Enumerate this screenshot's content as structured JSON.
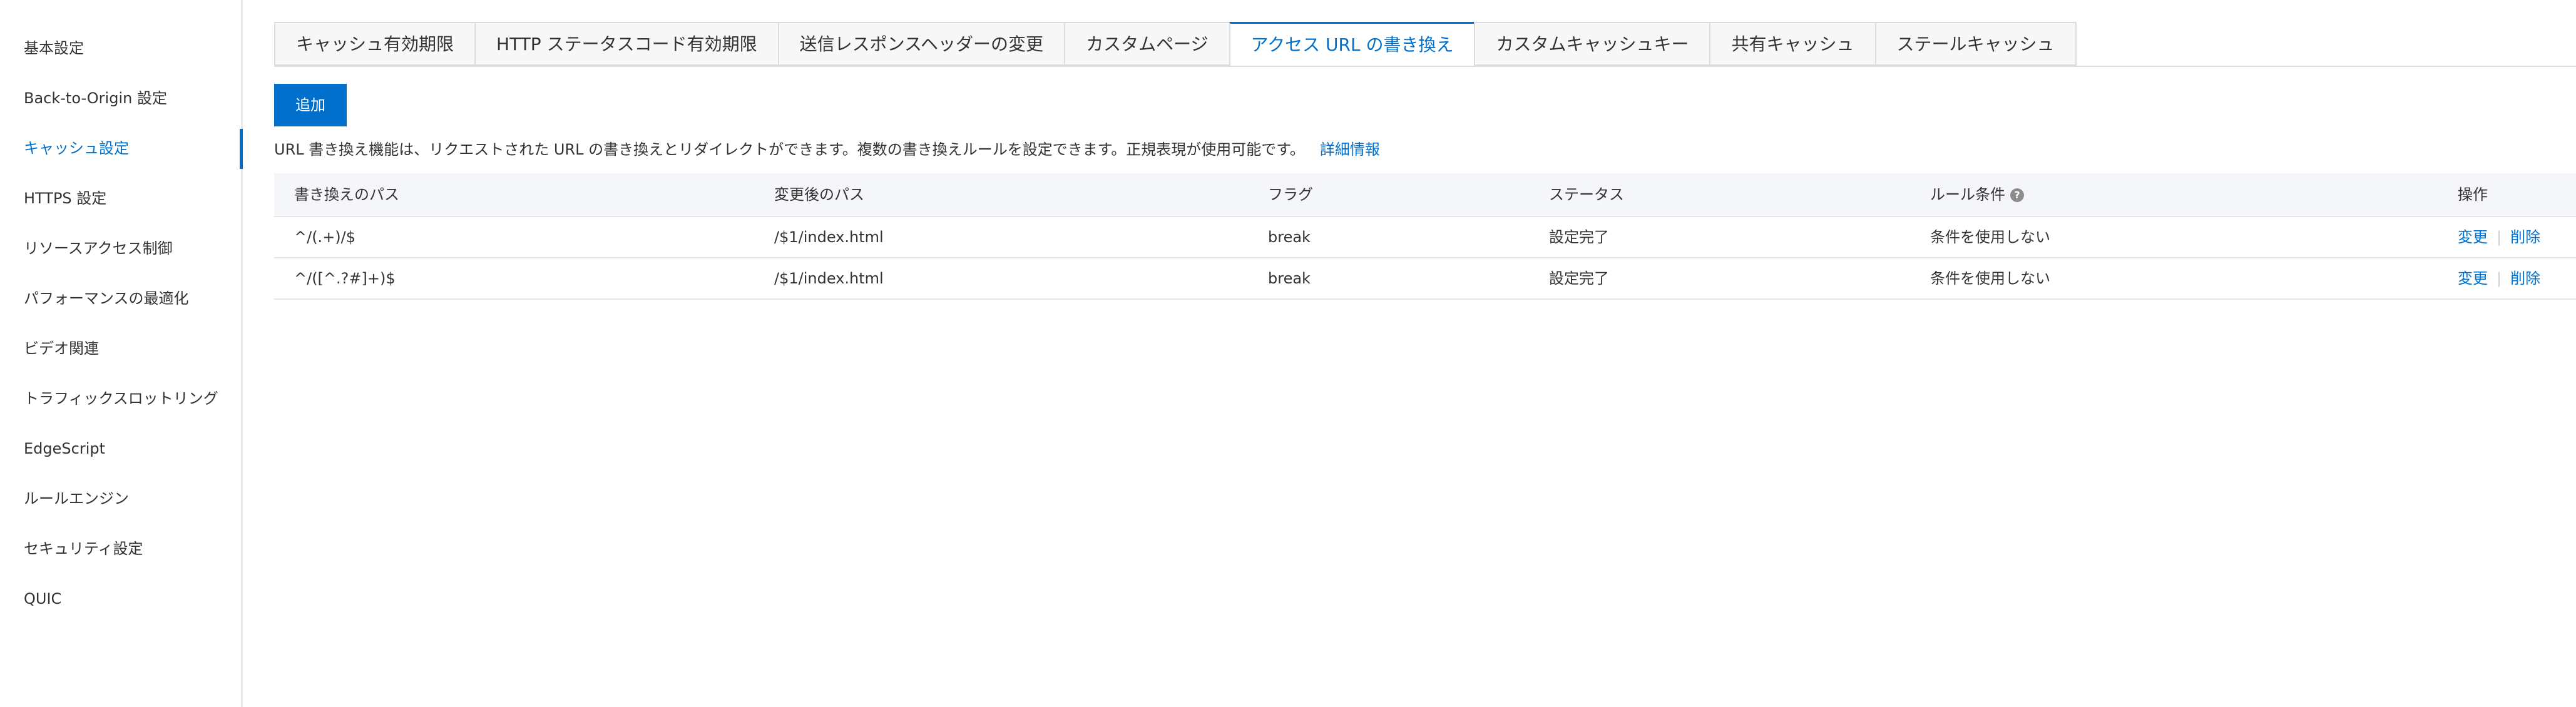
{
  "sidebar": {
    "items": [
      {
        "label": "基本設定"
      },
      {
        "label": "Back-to-Origin 設定"
      },
      {
        "label": "キャッシュ設定"
      },
      {
        "label": "HTTPS 設定"
      },
      {
        "label": "リソースアクセス制御"
      },
      {
        "label": "パフォーマンスの最適化"
      },
      {
        "label": "ビデオ関連"
      },
      {
        "label": "トラフィックスロットリング"
      },
      {
        "label": "EdgeScript"
      },
      {
        "label": "ルールエンジン"
      },
      {
        "label": "セキュリティ設定"
      },
      {
        "label": "QUIC"
      }
    ],
    "active_index": 2
  },
  "tabs": [
    {
      "label": "キャッシュ有効期限"
    },
    {
      "label": "HTTP ステータスコード有効期限"
    },
    {
      "label": "送信レスポンスヘッダーの変更"
    },
    {
      "label": "カスタムページ"
    },
    {
      "label": "アクセス URL の書き換え"
    },
    {
      "label": "カスタムキャッシュキー"
    },
    {
      "label": "共有キャッシュ"
    },
    {
      "label": "ステールキャッシュ"
    }
  ],
  "active_tab_index": 4,
  "toolbar": {
    "add_label": "追加"
  },
  "description": {
    "text": "URL 書き換え機能は、リクエストされた URL の書き換えとリダイレクトができます。複数の書き換えルールを設定できます。正規表現が使用可能です。",
    "link": "詳細情報"
  },
  "table": {
    "headers": {
      "original_path": "書き換えのパス",
      "target_path": "変更後のパス",
      "flag": "フラグ",
      "status": "ステータス",
      "rule_condition": "ルール条件",
      "help_icon": "?",
      "actions": "操作"
    },
    "rows": [
      {
        "original_path": "^/(.+)/$",
        "target_path": "/$1/index.html",
        "flag": "break",
        "status": "設定完了",
        "rule_condition": "条件を使用しない",
        "edit": "変更",
        "delete": "削除"
      },
      {
        "original_path": "^/([^.?#]+)$",
        "target_path": "/$1/index.html",
        "flag": "break",
        "status": "設定完了",
        "rule_condition": "条件を使用しない",
        "edit": "変更",
        "delete": "削除"
      }
    ],
    "separator": "|"
  },
  "colors": {
    "accent": "#0070cc",
    "header_bg": "#f5f6fa",
    "border": "#e5e5e5"
  }
}
